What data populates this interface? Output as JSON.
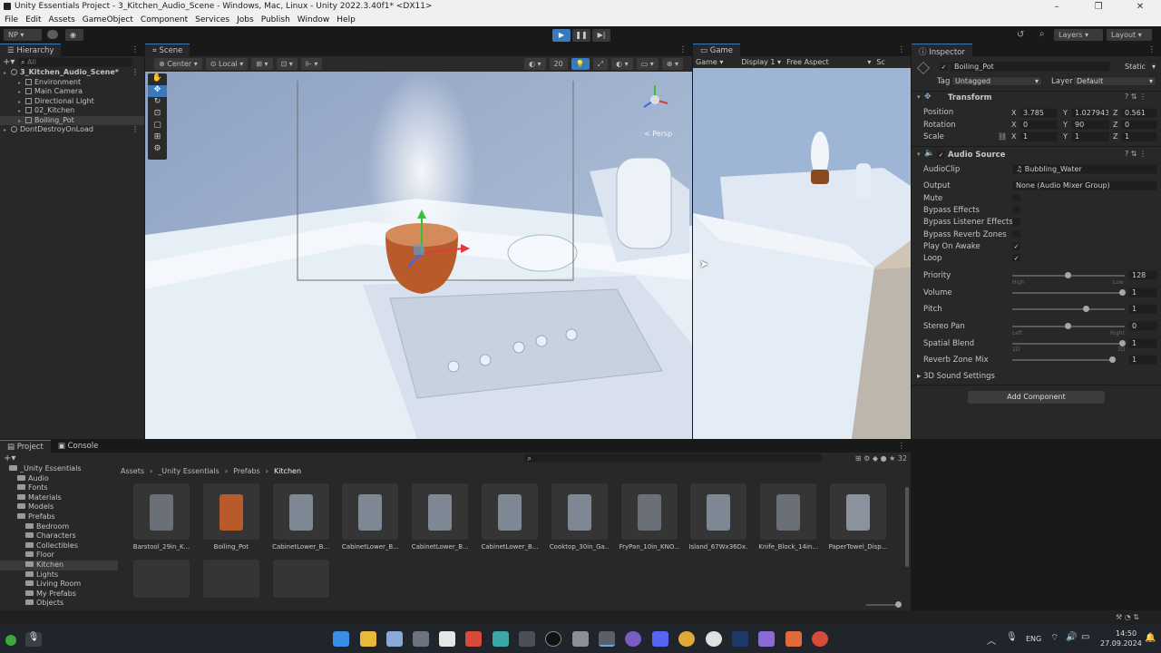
{
  "window": {
    "title": "Unity Essentials Project - 3_Kitchen_Audio_Scene - Windows, Mac, Linux - Unity 2022.3.40f1* <DX11>"
  },
  "menu": [
    "File",
    "Edit",
    "Assets",
    "GameObject",
    "Component",
    "Services",
    "Jobs",
    "Publish",
    "Window",
    "Help"
  ],
  "toolbar": {
    "account": "NP",
    "layers": "Layers",
    "layout": "Layout"
  },
  "hierarchy": {
    "tab": "Hierarchy",
    "search_placeholder": "All",
    "items": [
      {
        "label": "3_Kitchen_Audio_Scene*",
        "indent": 0,
        "kind": "scene",
        "bold": true
      },
      {
        "label": "Environment",
        "indent": 1,
        "kind": "obj"
      },
      {
        "label": "Main Camera",
        "indent": 1,
        "kind": "obj"
      },
      {
        "label": "Directional Light",
        "indent": 1,
        "kind": "obj"
      },
      {
        "label": "02_Kitchen",
        "indent": 1,
        "kind": "obj"
      },
      {
        "label": "Boiling_Pot",
        "indent": 1,
        "kind": "obj",
        "selected": true
      },
      {
        "label": "DontDestroyOnLoad",
        "indent": 0,
        "kind": "scene"
      }
    ]
  },
  "scene": {
    "tab": "Scene",
    "pivot": "Center",
    "space": "Local",
    "grid_snap": "20",
    "persp": "< Persp"
  },
  "game": {
    "tab": "Game",
    "mode": "Game",
    "display": "Display 1",
    "aspect": "Free Aspect",
    "scale": "Sc"
  },
  "inspector": {
    "tab": "Inspector",
    "object_name": "Boiling_Pot",
    "static": "Static",
    "tag_label": "Tag",
    "tag": "Untagged",
    "layer_label": "Layer",
    "layer": "Default",
    "transform": {
      "title": "Transform",
      "position_label": "Position",
      "rotation_label": "Rotation",
      "scale_label": "Scale",
      "position": {
        "x": "3.785",
        "y": "1.027943",
        "z": "0.561"
      },
      "rotation": {
        "x": "0",
        "y": "90",
        "z": "0"
      },
      "scale": {
        "x": "1",
        "y": "1",
        "z": "1"
      }
    },
    "audio": {
      "title": "Audio Source",
      "audioclip_label": "AudioClip",
      "audioclip": "Bubbling_Water",
      "output_label": "Output",
      "output": "None (Audio Mixer Group)",
      "mute": "Mute",
      "bypass_effects": "Bypass Effects",
      "bypass_listener": "Bypass Listener Effects",
      "bypass_reverb": "Bypass Reverb Zones",
      "play_on_awake": "Play On Awake",
      "loop": "Loop",
      "priority_label": "Priority",
      "priority": "128",
      "priority_low_hint": "High",
      "priority_high_hint": "Low",
      "volume_label": "Volume",
      "volume": "1",
      "pitch_label": "Pitch",
      "pitch": "1",
      "stereo_label": "Stereo Pan",
      "stereo": "0",
      "stereo_left": "Left",
      "stereo_right": "Right",
      "spatial_label": "Spatial Blend",
      "spatial": "1",
      "spatial_2d": "2D",
      "spatial_3d": "3D",
      "reverb_label": "Reverb Zone Mix",
      "reverb": "1",
      "sound3d": "3D Sound Settings"
    },
    "add_component": "Add Component"
  },
  "project": {
    "tab": "Project",
    "console_tab": "Console",
    "breadcrumb": [
      "Assets",
      "_Unity Essentials",
      "Prefabs",
      "Kitchen"
    ],
    "count": "32",
    "tree": [
      {
        "label": "_Unity Essentials",
        "indent": 0
      },
      {
        "label": "Audio",
        "indent": 1
      },
      {
        "label": "Fonts",
        "indent": 1
      },
      {
        "label": "Materials",
        "indent": 1
      },
      {
        "label": "Models",
        "indent": 1
      },
      {
        "label": "Prefabs",
        "indent": 1
      },
      {
        "label": "Bedroom",
        "indent": 2
      },
      {
        "label": "Characters",
        "indent": 2
      },
      {
        "label": "Collectibles",
        "indent": 2
      },
      {
        "label": "Floor",
        "indent": 2
      },
      {
        "label": "Kitchen",
        "indent": 2,
        "selected": true
      },
      {
        "label": "Lights",
        "indent": 2
      },
      {
        "label": "Living Room",
        "indent": 2
      },
      {
        "label": "My Prefabs",
        "indent": 2
      },
      {
        "label": "Objects",
        "indent": 2
      }
    ],
    "assets": [
      "Barstool_29in_K...",
      "Boiling_Pot",
      "CabinetLower_B...",
      "CabinetLower_B...",
      "CabinetLower_B...",
      "CabinetLower_B...",
      "Cooktop_30in_Ga...",
      "FryPan_10in_KNO...",
      "Island_67Wx36Dx...",
      "Knife_Block_14in...",
      "PaperTowel_Disp..."
    ]
  },
  "taskbar": {
    "lang": "ENG",
    "time": "14:50",
    "date": "27.09.2024"
  },
  "colors": {
    "accent": "#3a79bb",
    "play": "#4a9eea",
    "pot": "#b85a2a"
  }
}
